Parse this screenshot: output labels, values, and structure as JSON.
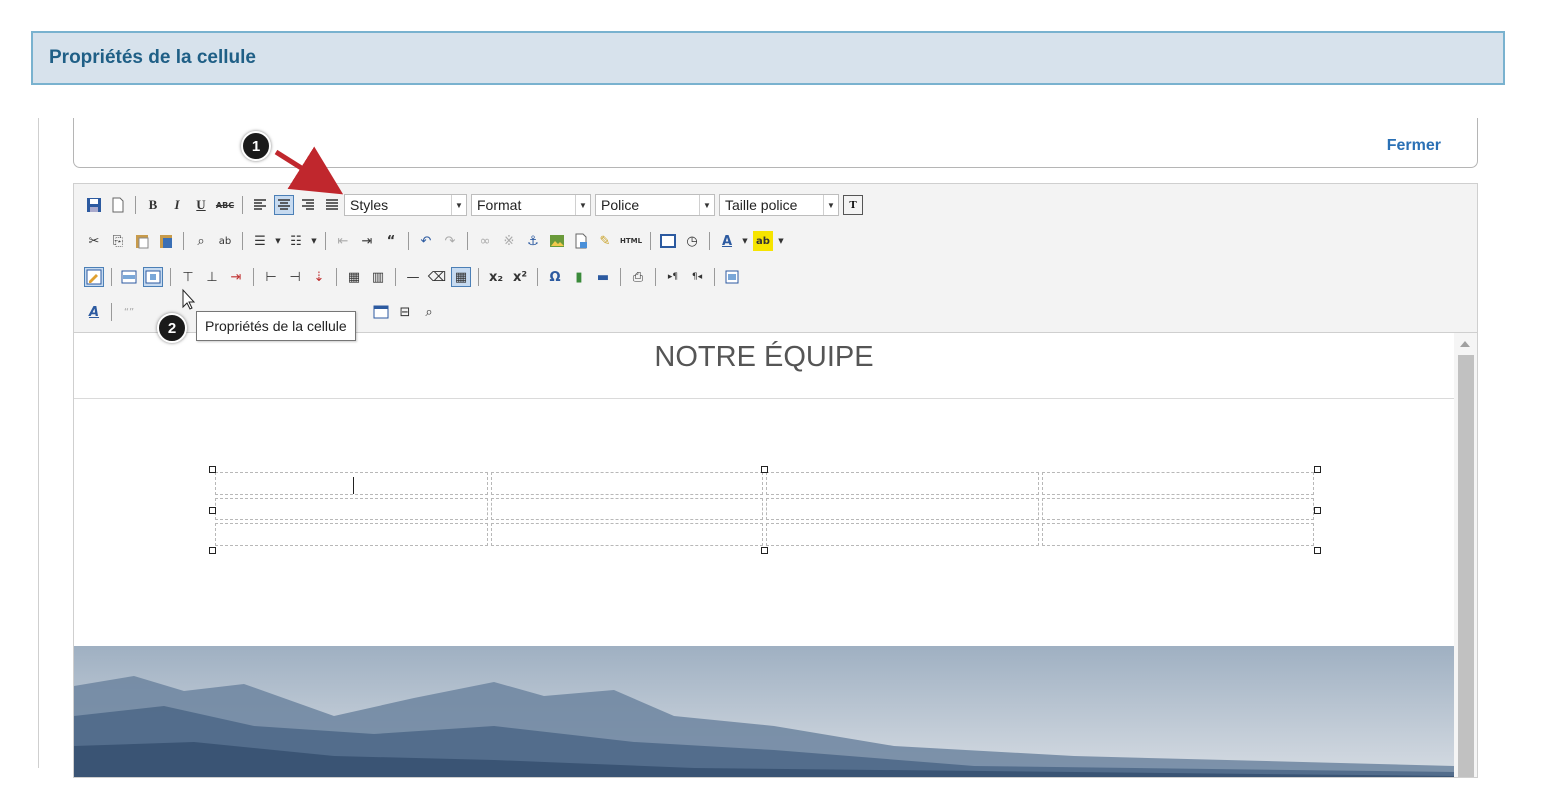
{
  "header": {
    "title": "Propriétés de la cellule"
  },
  "panel": {
    "close_label": "Fermer"
  },
  "toolbar": {
    "combos": [
      {
        "label": "Styles"
      },
      {
        "label": "Format"
      },
      {
        "label": "Police"
      },
      {
        "label": "Taille police"
      }
    ],
    "text_button_label": "T",
    "html_label": "HTML"
  },
  "editor": {
    "heading": "NOTRE ÉQUIPE"
  },
  "tooltip": {
    "text": "Propriétés de la cellule"
  },
  "callouts": [
    {
      "number": "1"
    },
    {
      "number": "2"
    }
  ],
  "colors": {
    "accent": "#2a70b5",
    "header_bg": "#d7e2ec",
    "header_border": "#79b2cf",
    "arrow": "#c0272d"
  }
}
